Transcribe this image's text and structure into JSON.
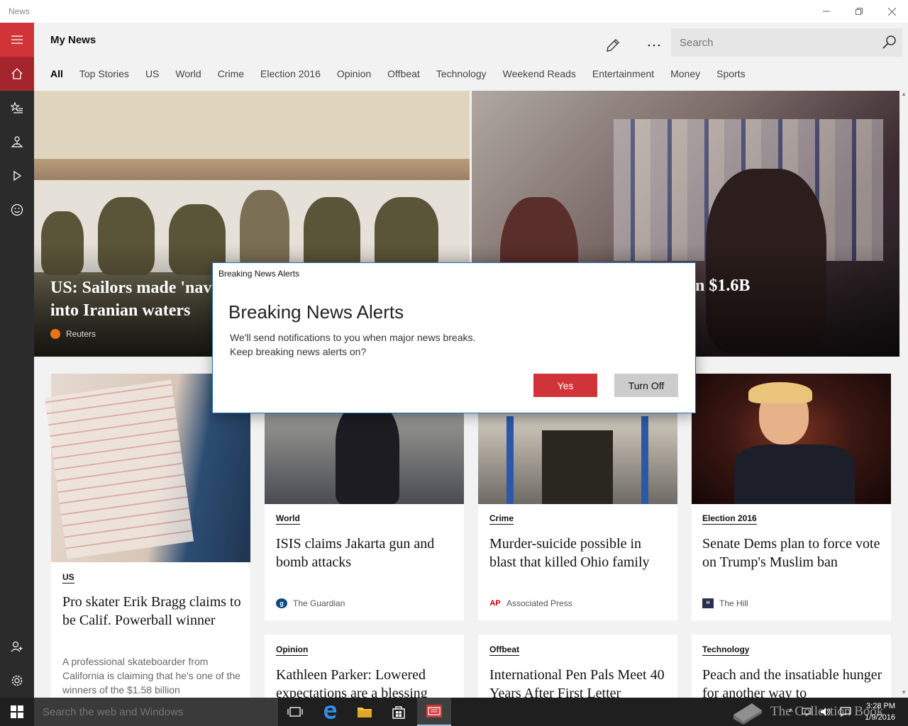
{
  "window": {
    "title": "News"
  },
  "header": {
    "title": "My News",
    "search_placeholder": "Search",
    "tabs": [
      "All",
      "Top Stories",
      "US",
      "World",
      "Crime",
      "Election 2016",
      "Opinion",
      "Offbeat",
      "Technology",
      "Weekend Reads",
      "Entertainment",
      "Money",
      "Sports"
    ],
    "active_tab": "All"
  },
  "hero": {
    "left": {
      "headline": "US: Sailors made 'nav\ninto Iranian waters",
      "source": "Reuters"
    },
    "right": {
      "headline": "n $1.6B"
    }
  },
  "cards": [
    {
      "category": "US",
      "title": "Pro skater Erik Bragg claims to be Calif. Powerball winner",
      "desc": "A professional skateboarder from California is claiming that he's one of the winners of the $1.58 billion"
    },
    {
      "category": "World",
      "title": "ISIS claims Jakarta gun and bomb attacks",
      "source": "The Guardian"
    },
    {
      "category": "Crime",
      "title": "Murder-suicide possible in blast that killed Ohio family",
      "source": "Associated Press"
    },
    {
      "category": "Election 2016",
      "title": "Senate Dems plan to force vote on Trump's Muslim ban",
      "source": "The Hill"
    },
    {
      "category": "Opinion",
      "title": "Kathleen Parker: Lowered expectations are a blessing"
    },
    {
      "category": "Offbeat",
      "title": "International Pen Pals Meet 40 Years After First Letter"
    },
    {
      "category": "Technology",
      "title": "Peach and the insatiable hunger for another way to"
    }
  ],
  "dialog": {
    "caption": "Breaking News Alerts",
    "title": "Breaking News Alerts",
    "message_line1": "We'll send notifications to you when major news breaks.",
    "message_line2": "Keep breaking news alerts on?",
    "yes_label": "Yes",
    "off_label": "Turn Off"
  },
  "taskbar": {
    "search_placeholder": "Search the web and Windows",
    "time": "3:28 PM",
    "date": "1/9/2016",
    "watermark": "The Collection Book"
  },
  "colors": {
    "accent": "#d13438",
    "rail": "#2b2b2b",
    "taskbar": "#1f1f1f"
  }
}
